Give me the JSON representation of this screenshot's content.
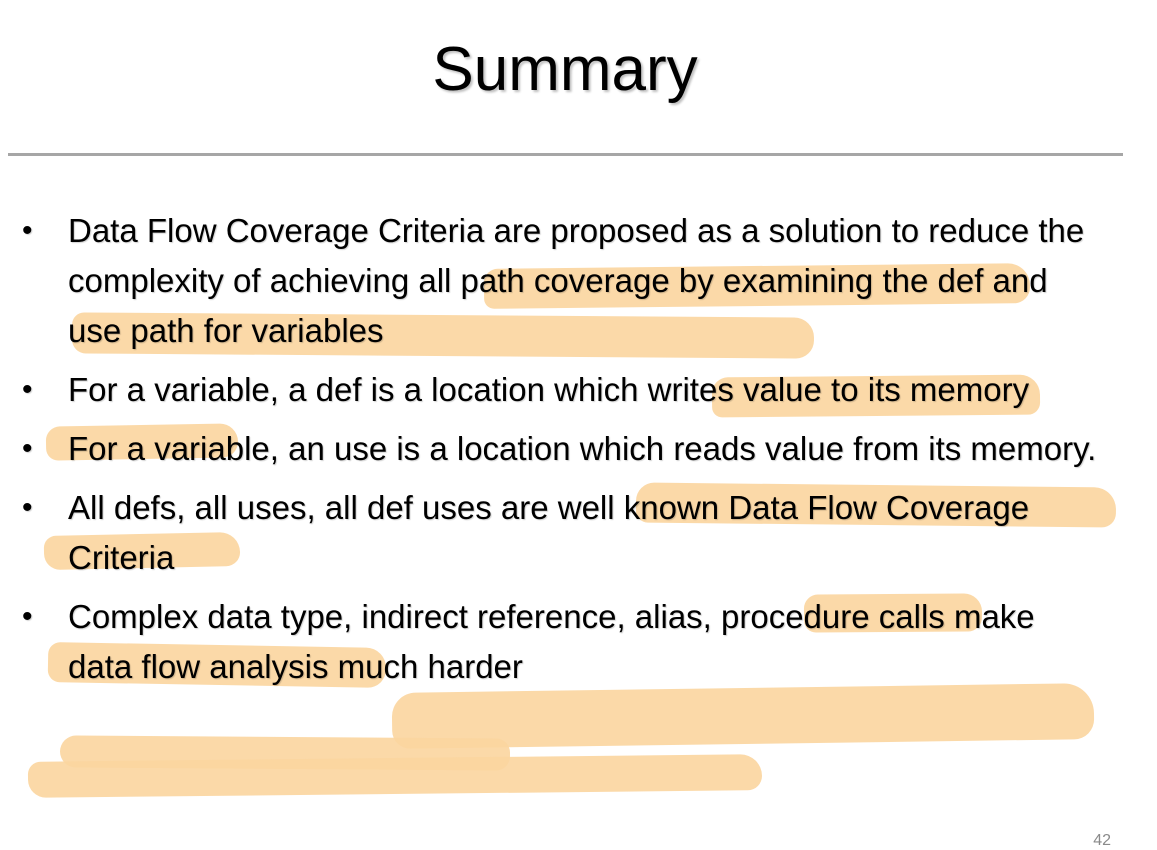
{
  "slide": {
    "title": "Summary",
    "page_number": "42",
    "highlight_color": "#fbd59e",
    "bullet_glyph": "•",
    "bullets": [
      {
        "before": "Data Flow Coverage Criteria are proposed as a solution to reduce the complexity of ",
        "highlight": "achieving all path coverage  by examining the def and use path for variables",
        "after": ""
      },
      {
        "before": "For a variable, a def is a location which ",
        "highlight": "writes value to its memory",
        "after": ""
      },
      {
        "before": "For a variable, an use is a location ",
        "highlight": "which reads value from its memory.",
        "after": ""
      },
      {
        "before": "All defs, all uses, all def uses are well known ",
        "highlight": "Data Flow Coverage Criteria",
        "after": ""
      },
      {
        "before": "Complex data type, ",
        "highlight": "indirect reference, alias, procedure calls make data flow analysis much harder",
        "after": ""
      }
    ]
  }
}
